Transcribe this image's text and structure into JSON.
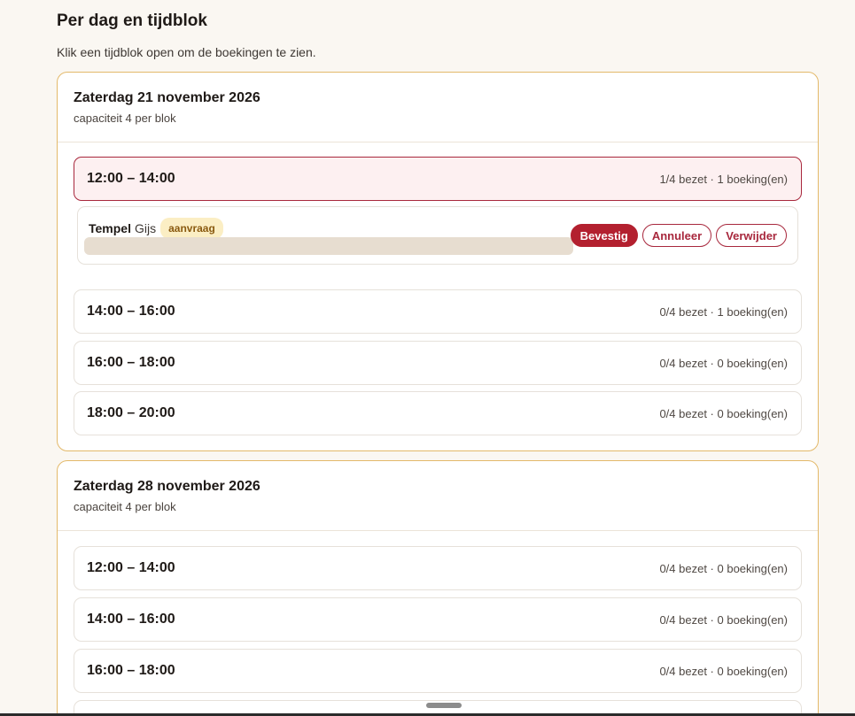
{
  "header": {
    "title": "Per dag en tijdblok",
    "subtitle": "Klik een tijdblok open om de boekingen te zien."
  },
  "days": [
    {
      "title": "Zaterdag 21 november 2026",
      "capacity": "capaciteit 4 per blok",
      "slots": [
        {
          "time": "12:00 – 14:00",
          "meta": "1/4 bezet · 1 boeking(en)"
        },
        {
          "time": "14:00 – 16:00",
          "meta": "0/4 bezet · 1 boeking(en)"
        },
        {
          "time": "16:00 – 18:00",
          "meta": "0/4 bezet · 0 boeking(en)"
        },
        {
          "time": "18:00 – 20:00",
          "meta": "0/4 bezet · 0 boeking(en)"
        }
      ],
      "booking": {
        "last_name": "Tempel",
        "first_name": "Gijs",
        "status": "aanvraag",
        "actions": {
          "confirm": "Bevestig",
          "cancel": "Annuleer",
          "delete": "Verwijder"
        }
      }
    },
    {
      "title": "Zaterdag 28 november 2026",
      "capacity": "capaciteit 4 per blok",
      "slots": [
        {
          "time": "12:00 – 14:00",
          "meta": "0/4 bezet · 0 boeking(en)"
        },
        {
          "time": "14:00 – 16:00",
          "meta": "0/4 bezet · 0 boeking(en)"
        },
        {
          "time": "16:00 – 18:00",
          "meta": "0/4 bezet · 0 boeking(en)"
        }
      ]
    }
  ],
  "colors": {
    "accent": "#b3202f",
    "card_border": "#e3b96a",
    "badge_bg": "#fbeec4",
    "page_bg": "#faf7f2"
  }
}
